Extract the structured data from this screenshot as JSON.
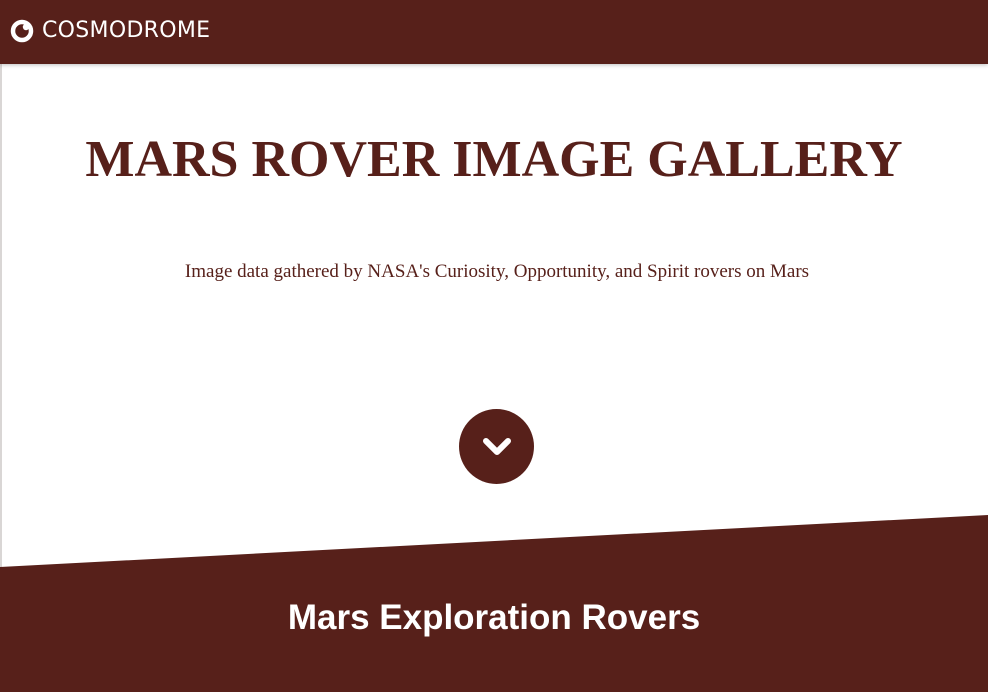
{
  "navbar": {
    "brand_name": "COSMODROME",
    "logo_icon": "cosmodrome-logo-icon"
  },
  "hero": {
    "title": "MARS ROVER IMAGE GALLERY",
    "subtitle": "Image data gathered by NASA's Curiosity, Opportunity, and Spirit rovers on Mars",
    "scroll_icon": "chevron-down-icon"
  },
  "section": {
    "title": "Mars Exploration Rovers"
  },
  "colors": {
    "primary": "#57201a",
    "background": "#ffffff",
    "text_light": "#ffffff"
  }
}
